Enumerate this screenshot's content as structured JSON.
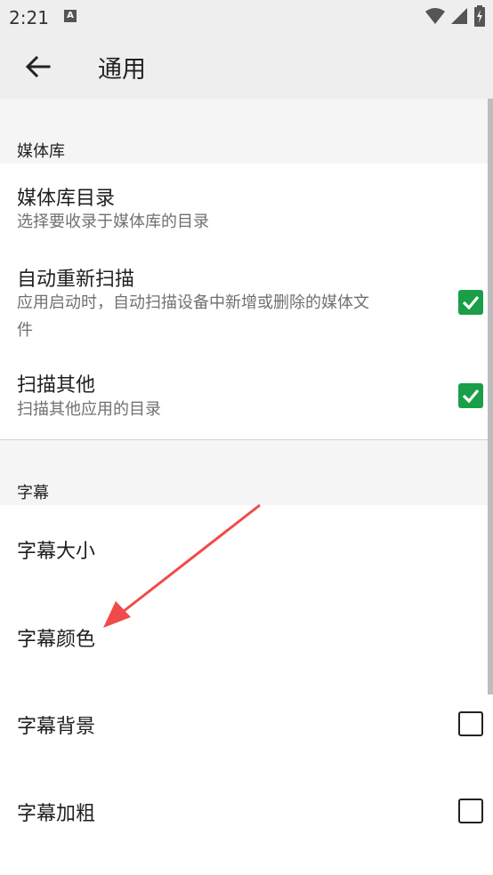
{
  "status_bar": {
    "time": "2:21",
    "notification_badge": "A",
    "icons": [
      "wifi-icon",
      "signal-icon",
      "battery-charging-icon"
    ]
  },
  "toolbar": {
    "title": "通用",
    "back_icon": "arrow-left-icon"
  },
  "sections": {
    "media": {
      "header": "媒体库",
      "items": [
        {
          "title": "媒体库目录",
          "summary": "选择要收录于媒体库的目录"
        },
        {
          "title": "自动重新扫描",
          "summary_line1": "应用启动时，自动扫描设备中新增或删除的媒体文",
          "summary_line2": "件",
          "checked": true
        },
        {
          "title": "扫描其他",
          "summary": "扫描其他应用的目录",
          "checked": true
        }
      ]
    },
    "subtitles": {
      "header": "字幕",
      "items": [
        {
          "title": "字幕大小"
        },
        {
          "title": "字幕颜色"
        },
        {
          "title": "字幕背景",
          "checked": false
        },
        {
          "title": "字幕加粗",
          "checked": false
        }
      ]
    }
  },
  "colors": {
    "accent": "#1a9e48",
    "annotation_arrow": "#f04a4a",
    "bar_background": "#eeeeee"
  }
}
